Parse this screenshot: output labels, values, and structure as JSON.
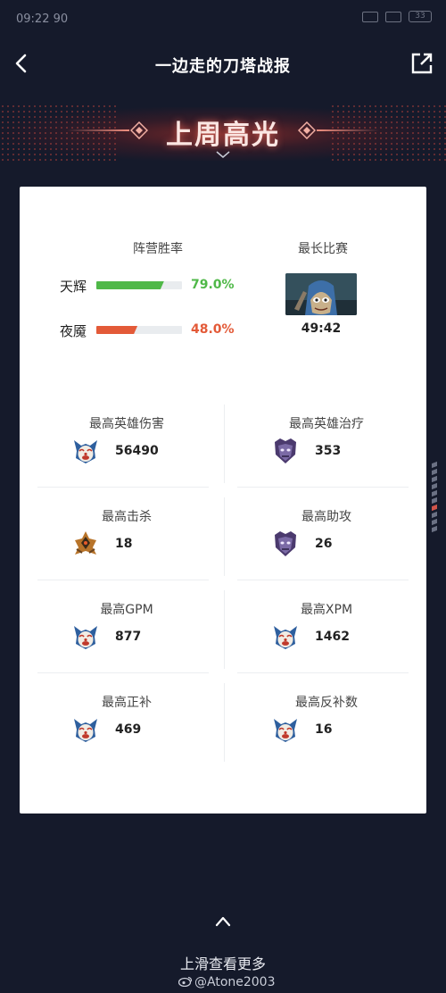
{
  "status_bar": {
    "time": "09:22 90",
    "battery": "33"
  },
  "nav": {
    "title": "一边走的刀塔战报"
  },
  "banner": {
    "title": "上周高光"
  },
  "win_rate": {
    "title": "阵营胜率",
    "rows": [
      {
        "label": "天辉",
        "percent_text": "79.0%",
        "fraction": 0.79,
        "color": "#4fb848"
      },
      {
        "label": "夜魇",
        "percent_text": "48.0%",
        "fraction": 0.48,
        "color": "#e35a38"
      }
    ]
  },
  "longest_game": {
    "title": "最长比赛",
    "duration": "49:42",
    "hero_icon": "meepo-hero-portrait"
  },
  "stats": [
    {
      "label": "最高英雄伤害",
      "value": "56490",
      "hero_icon": "clown-hero-icon"
    },
    {
      "label": "最高英雄治疗",
      "value": "353",
      "hero_icon": "shadow-demon-hero-icon"
    },
    {
      "label": "最高击杀",
      "value": "18",
      "hero_icon": "armored-hero-icon"
    },
    {
      "label": "最高助攻",
      "value": "26",
      "hero_icon": "shadow-demon-hero-icon"
    },
    {
      "label": "最高GPM",
      "value": "877",
      "hero_icon": "clown-hero-icon"
    },
    {
      "label": "最高XPM",
      "value": "1462",
      "hero_icon": "clown-hero-icon"
    },
    {
      "label": "最高正补",
      "value": "469",
      "hero_icon": "clown-hero-icon"
    },
    {
      "label": "最高反补数",
      "value": "16",
      "hero_icon": "clown-hero-icon"
    }
  ],
  "footer": {
    "swipe_text": "上滑查看更多",
    "watermark": "@Atone2003"
  },
  "colors": {
    "background": "#151a2b",
    "card": "#ffffff",
    "accent_red": "#e35a38",
    "accent_green": "#4fb848"
  }
}
